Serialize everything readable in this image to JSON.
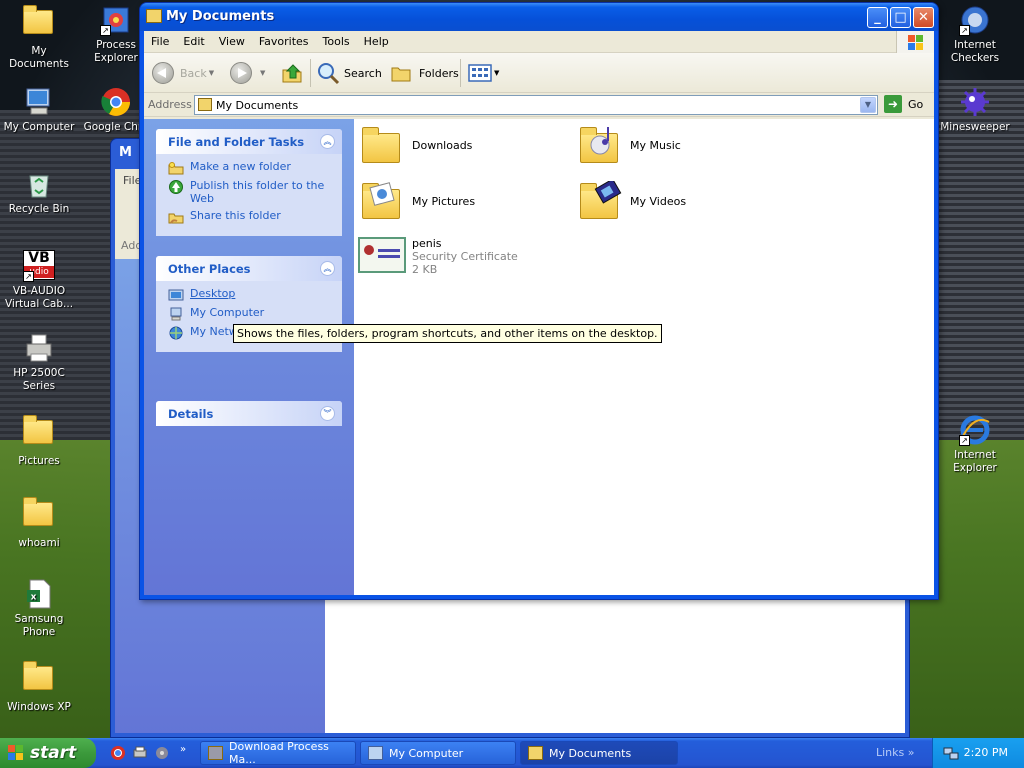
{
  "desktop": {
    "icons": [
      {
        "label": "My Documents"
      },
      {
        "label": "Process Explorer"
      },
      {
        "label": "My Computer"
      },
      {
        "label": "Google Chro"
      },
      {
        "label": "Recycle Bin"
      },
      {
        "label": "VB-AUDIO Virtual Cab..."
      },
      {
        "label": "HP 2500C Series"
      },
      {
        "label": "Pictures"
      },
      {
        "label": "whoami"
      },
      {
        "label": "Samsung Phone"
      },
      {
        "label": "Windows XP"
      },
      {
        "label": "Internet Checkers"
      },
      {
        "label": "Minesweeper"
      },
      {
        "label": "Internet Explorer"
      }
    ],
    "vb_logo_top": "VB",
    "vb_logo_bottom": "udio"
  },
  "background_window": {
    "title": "M",
    "menu_fragment": "File",
    "address_fragment": "Add"
  },
  "window": {
    "title": "My Documents",
    "menu": [
      "File",
      "Edit",
      "View",
      "Favorites",
      "Tools",
      "Help"
    ],
    "toolbar": {
      "back": "Back",
      "search": "Search",
      "folders": "Folders"
    },
    "address": {
      "label": "Address",
      "value": "My Documents",
      "go": "Go"
    },
    "tasks_panel": {
      "title": "File and Folder Tasks",
      "items": [
        "Make a new folder",
        "Publish this folder to the Web",
        "Share this folder"
      ]
    },
    "places_panel": {
      "title": "Other Places",
      "items": [
        "Desktop",
        "My Computer",
        "My Netw"
      ]
    },
    "details_panel": {
      "title": "Details"
    },
    "files": [
      {
        "name": "Downloads"
      },
      {
        "name": "My Music"
      },
      {
        "name": "My Pictures"
      },
      {
        "name": "My Videos"
      },
      {
        "name": "penis",
        "type": "Security Certificate",
        "size": "2 KB"
      }
    ],
    "tooltip": "Shows the files, folders, program shortcuts, and other items on the desktop."
  },
  "taskbar": {
    "start": "start",
    "buttons": [
      "Download Process Ma...",
      "My Computer",
      "My Documents"
    ],
    "links": "Links",
    "clock": "2:20 PM"
  }
}
